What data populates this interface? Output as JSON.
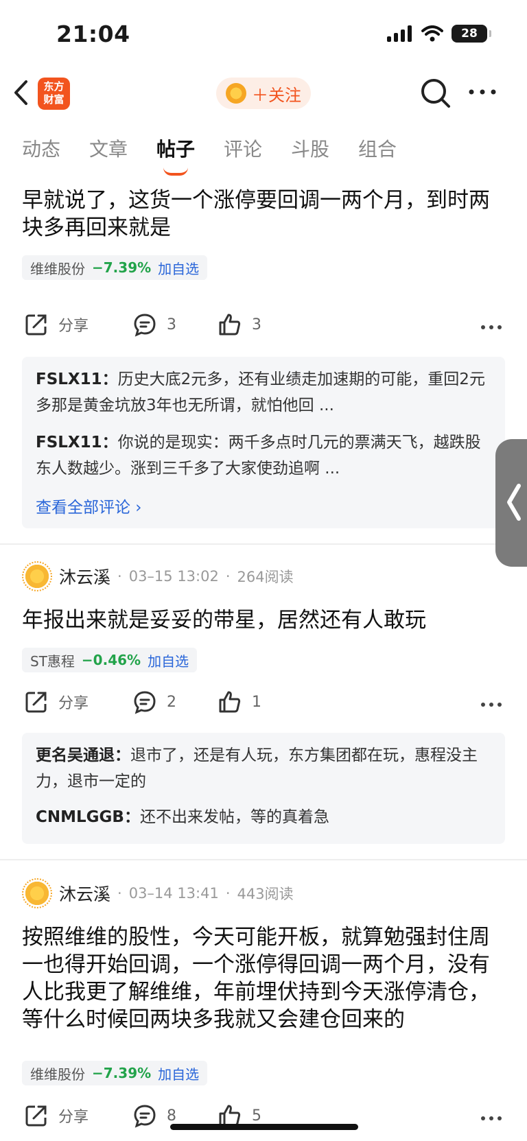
{
  "status": {
    "time": "21:04",
    "battery": "28"
  },
  "header": {
    "logo_text": "东方\n财富",
    "follow_label": "＋关注"
  },
  "tabs": [
    {
      "label": "动态"
    },
    {
      "label": "文章"
    },
    {
      "label": "帖子"
    },
    {
      "label": "评论"
    },
    {
      "label": "斗股"
    },
    {
      "label": "组合"
    }
  ],
  "posts": [
    {
      "text": "早就说了，这货一个涨停要回调一两个月，到时两块多再回来就是",
      "stock": {
        "name": "维维股份",
        "change": "−7.39%",
        "add": "加自选"
      },
      "actions": {
        "share": "分享",
        "comments": "3",
        "likes": "3"
      },
      "comments": [
        {
          "user": "FSLX11：",
          "text": "历史大底2元多，还有业绩走加速期的可能，重回2元多那是黄金坑放3年也无所谓，就怕他回 ..."
        },
        {
          "user": "FSLX11：",
          "text": "你说的是现实：两千多点时几元的票满天飞，越跌股东人数越少。涨到三千多了大家使劲追啊 ..."
        }
      ],
      "view_all": "查看全部评论 ›"
    },
    {
      "author": "沐云溪",
      "date": "03–15 13:02",
      "reads": "264阅读",
      "text": "年报出来就是妥妥的带星，居然还有人敢玩",
      "stock": {
        "name": "ST惠程",
        "change": "−0.46%",
        "add": "加自选"
      },
      "actions": {
        "share": "分享",
        "comments": "2",
        "likes": "1"
      },
      "comments": [
        {
          "user": "更名吴通退：",
          "text": "退市了，还是有人玩，东方集团都在玩，惠程没主力，退市一定的"
        },
        {
          "user": "CNMLGGB：",
          "text": "还不出来发帖，等的真着急"
        }
      ]
    },
    {
      "author": "沐云溪",
      "date": "03–14 13:41",
      "reads": "443阅读",
      "text": "按照维维的股性，今天可能开板，就算勉强封住周一也得开始回调，一个涨停得回调一两个月，没有人比我更了解维维，年前埋伏持到今天涨停清仓，等什么时候回两块多我就又会建仓回来的",
      "stock": {
        "name": "维维股份",
        "change": "−7.39%",
        "add": "加自选"
      },
      "actions": {
        "share": "分享",
        "comments": "8",
        "likes": "5"
      }
    }
  ],
  "colors": {
    "accent": "#f2541e",
    "down": "#22a34a",
    "link": "#2a66d9"
  }
}
